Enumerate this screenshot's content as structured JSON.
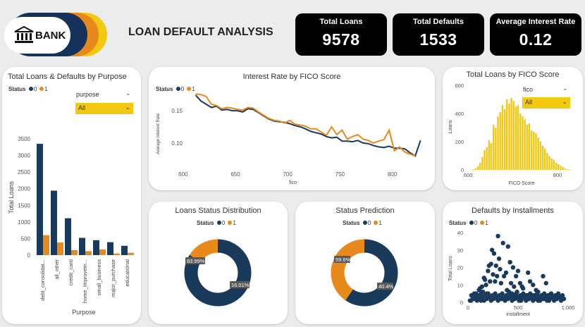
{
  "header": {
    "logo_text": "BANK",
    "title": "LOAN DEFAULT ANALYSIS"
  },
  "kpis": [
    {
      "label": "Total Loans",
      "value": "9578"
    },
    {
      "label": "Total Defaults",
      "value": "1533"
    },
    {
      "label": "Average Interest Rate",
      "value": "0.12"
    }
  ],
  "colors": {
    "status0": "#1a3a5c",
    "status1": "#e8891c",
    "slicer": "#f2c811",
    "bars": "#f2c811"
  },
  "legend": {
    "label": "Status",
    "s0": "0",
    "s1": "1"
  },
  "purpose_chart": {
    "title": "Total Loans & Defaults by Purpose",
    "slicer_label": "purpose",
    "slicer_value": "All",
    "xlabel": "Purpose",
    "ylabel": "Total Loans"
  },
  "interest_chart": {
    "title": "Interest Rate by FICO Score",
    "xlabel": "fico",
    "ylabel": "Average Interest Rate"
  },
  "fico_chart": {
    "title": "Total Loans by FICO Score",
    "slicer_label": "fico",
    "slicer_value": "All",
    "xlabel": "FICO Score",
    "ylabel": "Loans"
  },
  "status_dist": {
    "title": "Loans Status Distribution",
    "label0": "83.99%",
    "label1": "16.01%"
  },
  "status_pred": {
    "title": "Status Prediction",
    "label0": "59.6%",
    "label1": "40.4%"
  },
  "installments_chart": {
    "title": "Defaults by Installments",
    "xlabel": "installment",
    "ylabel": "Total Loans"
  },
  "chart_data": [
    {
      "type": "bar",
      "title": "Total Loans & Defaults by Purpose",
      "categories": [
        "debt_consolidat...",
        "all_other",
        "credit_card",
        "home_improvem...",
        "small_business",
        "major_purchase",
        "educational"
      ],
      "series": [
        {
          "name": "0",
          "values": [
            3350,
            1940,
            1110,
            520,
            450,
            390,
            280
          ]
        },
        {
          "name": "1",
          "values": [
            600,
            380,
            150,
            120,
            170,
            50,
            70
          ]
        }
      ],
      "xlabel": "Purpose",
      "ylabel": "Total Loans",
      "ylim": [
        0,
        3500
      ],
      "yticks": [
        0,
        500,
        1000,
        1500,
        2000,
        2500,
        3000,
        3500
      ],
      "legend": "top-left"
    },
    {
      "type": "line",
      "title": "Interest Rate by FICO Score",
      "xlabel": "fico",
      "ylabel": "Average Interest Rate",
      "xlim": [
        590,
        830
      ],
      "ylim": [
        0.065,
        0.185
      ],
      "xticks": [
        600,
        650,
        700,
        750,
        800
      ],
      "yticks": [
        0.1,
        0.15
      ],
      "series": [
        {
          "name": "0",
          "x": [
            612,
            617,
            622,
            627,
            632,
            637,
            642,
            647,
            652,
            657,
            662,
            667,
            672,
            677,
            682,
            687,
            692,
            697,
            702,
            707,
            712,
            717,
            722,
            727,
            732,
            737,
            742,
            747,
            752,
            757,
            762,
            767,
            772,
            777,
            782,
            787,
            792,
            797,
            802,
            807,
            812,
            817,
            822,
            827
          ],
          "y": [
            0.174,
            0.165,
            0.16,
            0.155,
            0.157,
            0.151,
            0.152,
            0.15,
            0.15,
            0.148,
            0.153,
            0.152,
            0.147,
            0.142,
            0.137,
            0.134,
            0.133,
            0.132,
            0.13,
            0.127,
            0.125,
            0.122,
            0.118,
            0.116,
            0.114,
            0.11,
            0.108,
            0.109,
            0.103,
            0.103,
            0.102,
            0.104,
            0.1,
            0.099,
            0.096,
            0.094,
            0.093,
            0.095,
            0.092,
            0.092,
            0.091,
            0.085,
            0.08,
            0.104
          ]
        },
        {
          "name": "1",
          "x": [
            612,
            617,
            622,
            627,
            632,
            637,
            642,
            647,
            652,
            657,
            662,
            667,
            672,
            677,
            682,
            687,
            692,
            697,
            702,
            707,
            712,
            717,
            722,
            727,
            732,
            737,
            742,
            747,
            752,
            757,
            762,
            767,
            772,
            777,
            782,
            787,
            792,
            797,
            802,
            807,
            812,
            817,
            822
          ],
          "y": [
            0.176,
            0.175,
            0.172,
            0.16,
            0.158,
            0.153,
            0.155,
            0.154,
            0.152,
            0.151,
            0.155,
            0.154,
            0.148,
            0.143,
            0.138,
            0.135,
            0.134,
            0.131,
            0.135,
            0.129,
            0.128,
            0.126,
            0.122,
            0.122,
            0.117,
            0.112,
            0.125,
            0.113,
            0.12,
            0.106,
            0.11,
            0.113,
            0.106,
            0.104,
            0.1,
            0.103,
            0.105,
            0.12,
            0.088,
            0.094,
            0.086,
            0.083,
            0.08
          ]
        }
      ],
      "legend": "top-left"
    },
    {
      "type": "bar",
      "title": "Total Loans by FICO Score",
      "xlabel": "FICO Score",
      "ylabel": "Loans",
      "xlim": [
        600,
        830
      ],
      "ylim": [
        0,
        600
      ],
      "xticks": [
        600,
        800
      ],
      "yticks": [
        0,
        200,
        400,
        600
      ],
      "x": [
        612,
        617,
        622,
        627,
        632,
        637,
        642,
        647,
        652,
        657,
        662,
        667,
        672,
        677,
        682,
        687,
        692,
        697,
        702,
        707,
        712,
        717,
        722,
        727,
        732,
        737,
        742,
        747,
        752,
        757,
        762,
        767,
        772,
        777,
        782,
        787,
        792,
        797,
        802,
        807,
        812,
        817,
        822,
        827
      ],
      "values": [
        5,
        10,
        25,
        50,
        90,
        140,
        160,
        210,
        190,
        320,
        300,
        380,
        410,
        460,
        430,
        500,
        470,
        510,
        490,
        450,
        460,
        400,
        380,
        360,
        320,
        330,
        280,
        270,
        260,
        230,
        200,
        170,
        150,
        120,
        100,
        80,
        70,
        50,
        40,
        30,
        20,
        10,
        5,
        3
      ]
    },
    {
      "type": "pie",
      "title": "Loans Status Distribution",
      "categories": [
        "0",
        "1"
      ],
      "values": [
        83.99,
        16.01
      ]
    },
    {
      "type": "pie",
      "title": "Status Prediction",
      "categories": [
        "0",
        "1"
      ],
      "values": [
        59.6,
        40.4
      ]
    },
    {
      "type": "scatter",
      "title": "Defaults by Installments",
      "xlabel": "installment",
      "ylabel": "Total Loans",
      "xlim": [
        0,
        1000
      ],
      "ylim": [
        0,
        40
      ],
      "xticks": [
        0,
        500,
        1000
      ],
      "yticks": [
        0,
        10,
        20,
        30,
        40
      ],
      "series": [
        {
          "name": "0",
          "x": [
            60,
            80,
            100,
            120,
            150,
            160,
            180,
            200,
            220,
            230,
            250,
            260,
            280,
            300,
            310,
            320,
            350,
            380,
            400,
            420,
            450,
            480,
            500,
            520,
            550,
            600,
            650,
            700,
            750,
            800,
            850,
            900,
            950,
            140,
            170,
            210,
            240,
            270,
            330,
            360,
            390,
            410,
            440,
            470,
            510,
            540,
            580,
            620,
            680,
            720,
            780,
            830,
            880,
            30,
            50,
            90,
            110,
            130,
            190,
            290,
            340,
            370,
            430,
            460,
            490,
            530,
            560,
            610,
            640,
            700,
            760,
            810,
            860,
            930
          ],
          "y": [
            2,
            5,
            3,
            8,
            6,
            14,
            10,
            18,
            12,
            22,
            16,
            28,
            21,
            38,
            25,
            19,
            34,
            17,
            32,
            23,
            20,
            15,
            18,
            11,
            8,
            17,
            10,
            6,
            15,
            4,
            3,
            4,
            2,
            9,
            13,
            21,
            30,
            12,
            11,
            15,
            7,
            6,
            5,
            3,
            2,
            9,
            4,
            12,
            7,
            3,
            11,
            5,
            2,
            1,
            2,
            4,
            7,
            1,
            5,
            15,
            2,
            3,
            11,
            9,
            6,
            1,
            3,
            2,
            4,
            1,
            2,
            1,
            2,
            3
          ]
        }
      ],
      "legend": "top-left"
    }
  ]
}
